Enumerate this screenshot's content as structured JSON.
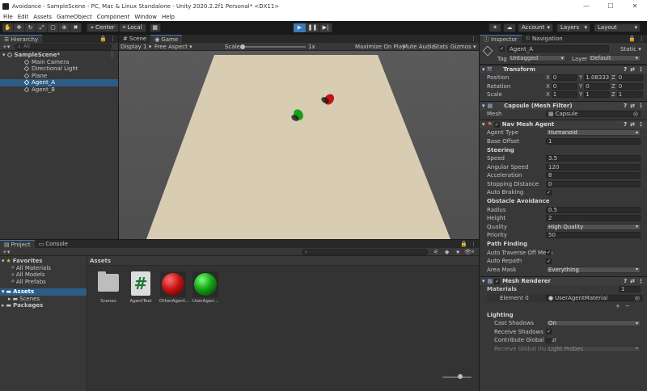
{
  "window": {
    "title": "Avoidance - SampleScene - PC, Mac & Linux Standalone - Unity 2020.2.2f1 Personal* <DX11>",
    "minimize": "—",
    "maximize": "☐",
    "close": "✕"
  },
  "menu": [
    "File",
    "Edit",
    "Assets",
    "GameObject",
    "Component",
    "Window",
    "Help"
  ],
  "toolbar": {
    "pivot": "Center",
    "space": "Local",
    "account": "Account",
    "layers": "Layers",
    "layout": "Layout"
  },
  "hierarchy": {
    "tab": "Hierarchy",
    "search_placeholder": "All",
    "scene": "SampleScene*",
    "items": [
      "Main Camera",
      "Directional Light",
      "Plane",
      "Agent_A",
      "Agent_B"
    ],
    "selected": "Agent_A"
  },
  "scene_tabs": {
    "scene": "Scene",
    "game": "Game"
  },
  "game_bar": {
    "display": "Display 1",
    "aspect": "Free Aspect",
    "scale_label": "Scale",
    "scale_value": "1x",
    "maximize": "Maximize On Play",
    "mute": "Mute Audio",
    "stats": "Stats",
    "gizmos": "Gizmos"
  },
  "project": {
    "tab_project": "Project",
    "tab_console": "Console",
    "favorites": "Favorites",
    "favorite_items": [
      "All Materials",
      "All Models",
      "All Prefabs"
    ],
    "assets_root": "Assets",
    "asset_folders": [
      "Scenes"
    ],
    "packages": "Packages",
    "breadcrumb": "Assets",
    "hidden_count": "9",
    "assets": [
      {
        "name": "Scenes",
        "kind": "folder"
      },
      {
        "name": "AgentTest",
        "kind": "script"
      },
      {
        "name": "OtherAgent...",
        "kind": "red-material"
      },
      {
        "name": "UserAgen...",
        "kind": "green-material"
      }
    ]
  },
  "inspector": {
    "tab_inspector": "Inspector",
    "tab_navigation": "Navigation",
    "object_name": "Agent_A",
    "static_label": "Static",
    "tag_label": "Tag",
    "tag_value": "Untagged",
    "layer_label": "Layer",
    "layer_value": "Default",
    "transform": {
      "title": "Transform",
      "position_label": "Position",
      "position": {
        "x": "0",
        "y": "1.083333",
        "z": "0"
      },
      "rotation_label": "Rotation",
      "rotation": {
        "x": "0",
        "y": "0",
        "z": "0"
      },
      "scale_label": "Scale",
      "scale": {
        "x": "1",
        "y": "1",
        "z": "1"
      }
    },
    "mesh_filter": {
      "title": "Capsule (Mesh Filter)",
      "mesh_label": "Mesh",
      "mesh_value": "Capsule"
    },
    "nav_agent": {
      "title": "Nav Mesh Agent",
      "agent_type_label": "Agent Type",
      "agent_type": "Humanoid",
      "base_offset_label": "Base Offset",
      "base_offset": "1",
      "steering_header": "Steering",
      "speed_label": "Speed",
      "speed": "3.5",
      "angular_label": "Angular Speed",
      "angular": "120",
      "accel_label": "Acceleration",
      "accel": "8",
      "stopping_label": "Stopping Distance",
      "stopping": "0",
      "braking_label": "Auto Braking",
      "avoid_header": "Obstacle Avoidance",
      "radius_label": "Radius",
      "radius": "0.5",
      "height_label": "Height",
      "height": "2",
      "quality_label": "Quality",
      "quality": "High Quality",
      "priority_label": "Priority",
      "priority": "50",
      "path_header": "Path Finding",
      "traverse_label": "Auto Traverse Off Mesh",
      "repath_label": "Auto Repath",
      "area_label": "Area Mask",
      "area": "Everything"
    },
    "mesh_renderer": {
      "title": "Mesh Renderer",
      "materials_label": "Materials",
      "materials_count": "1",
      "element_label": "Element 0",
      "element_value": "UserAgentMaterial",
      "lighting_header": "Lighting",
      "cast_label": "Cast Shadows",
      "cast_value": "On",
      "receive_label": "Receive Shadows",
      "gi_label": "Contribute Global Illur",
      "receive_gi_label": "Receive Global Illumi",
      "receive_gi_value": "Light Probes"
    },
    "checkmark": "✓",
    "plus": "+",
    "minus": "−"
  },
  "colors": {
    "agent_red": "#c41414",
    "agent_green": "#16a216",
    "plane": "#d8ccb2",
    "selection": "#2c5d87",
    "play_active": "#3a79bb"
  }
}
